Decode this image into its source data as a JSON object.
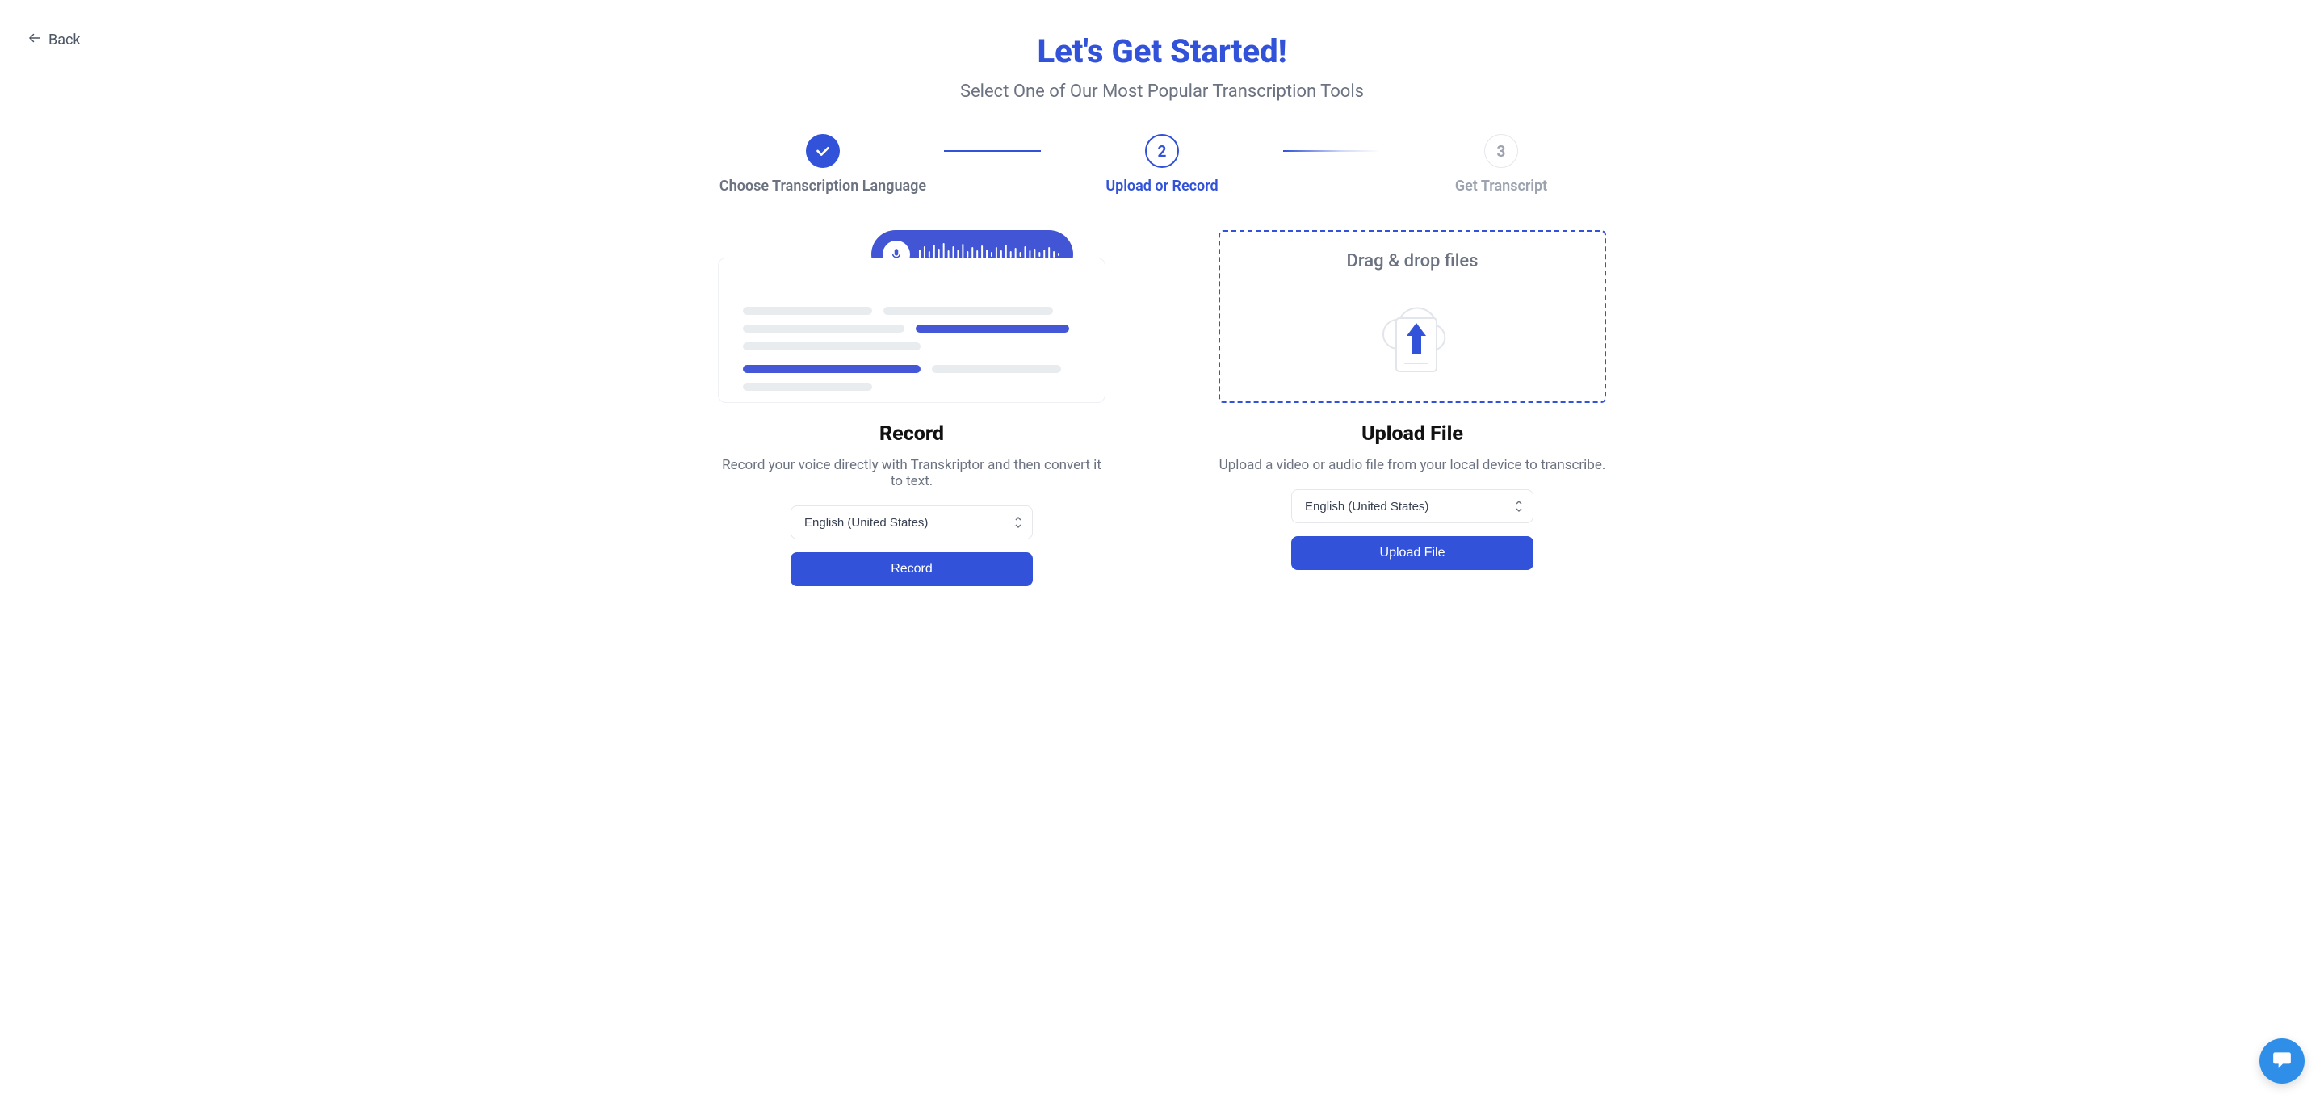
{
  "nav": {
    "back": "Back"
  },
  "header": {
    "title": "Let's Get Started!",
    "subtitle": "Select One of Our Most Popular Transcription Tools"
  },
  "steps": {
    "step1": {
      "label": "Choose Transcription Language"
    },
    "step2": {
      "number": "2",
      "label": "Upload or Record"
    },
    "step3": {
      "number": "3",
      "label": "Get Transcript"
    }
  },
  "record": {
    "title": "Record",
    "description": "Record your voice directly with Transkriptor and then convert it to text.",
    "language": "English (United States)",
    "button": "Record"
  },
  "upload": {
    "dropzone_label": "Drag & drop files",
    "title": "Upload File",
    "description": "Upload a video or audio file from your local device to transcribe.",
    "language": "English (United States)",
    "button": "Upload File"
  },
  "colors": {
    "primary": "#3152d9",
    "muted": "#6b7280"
  }
}
